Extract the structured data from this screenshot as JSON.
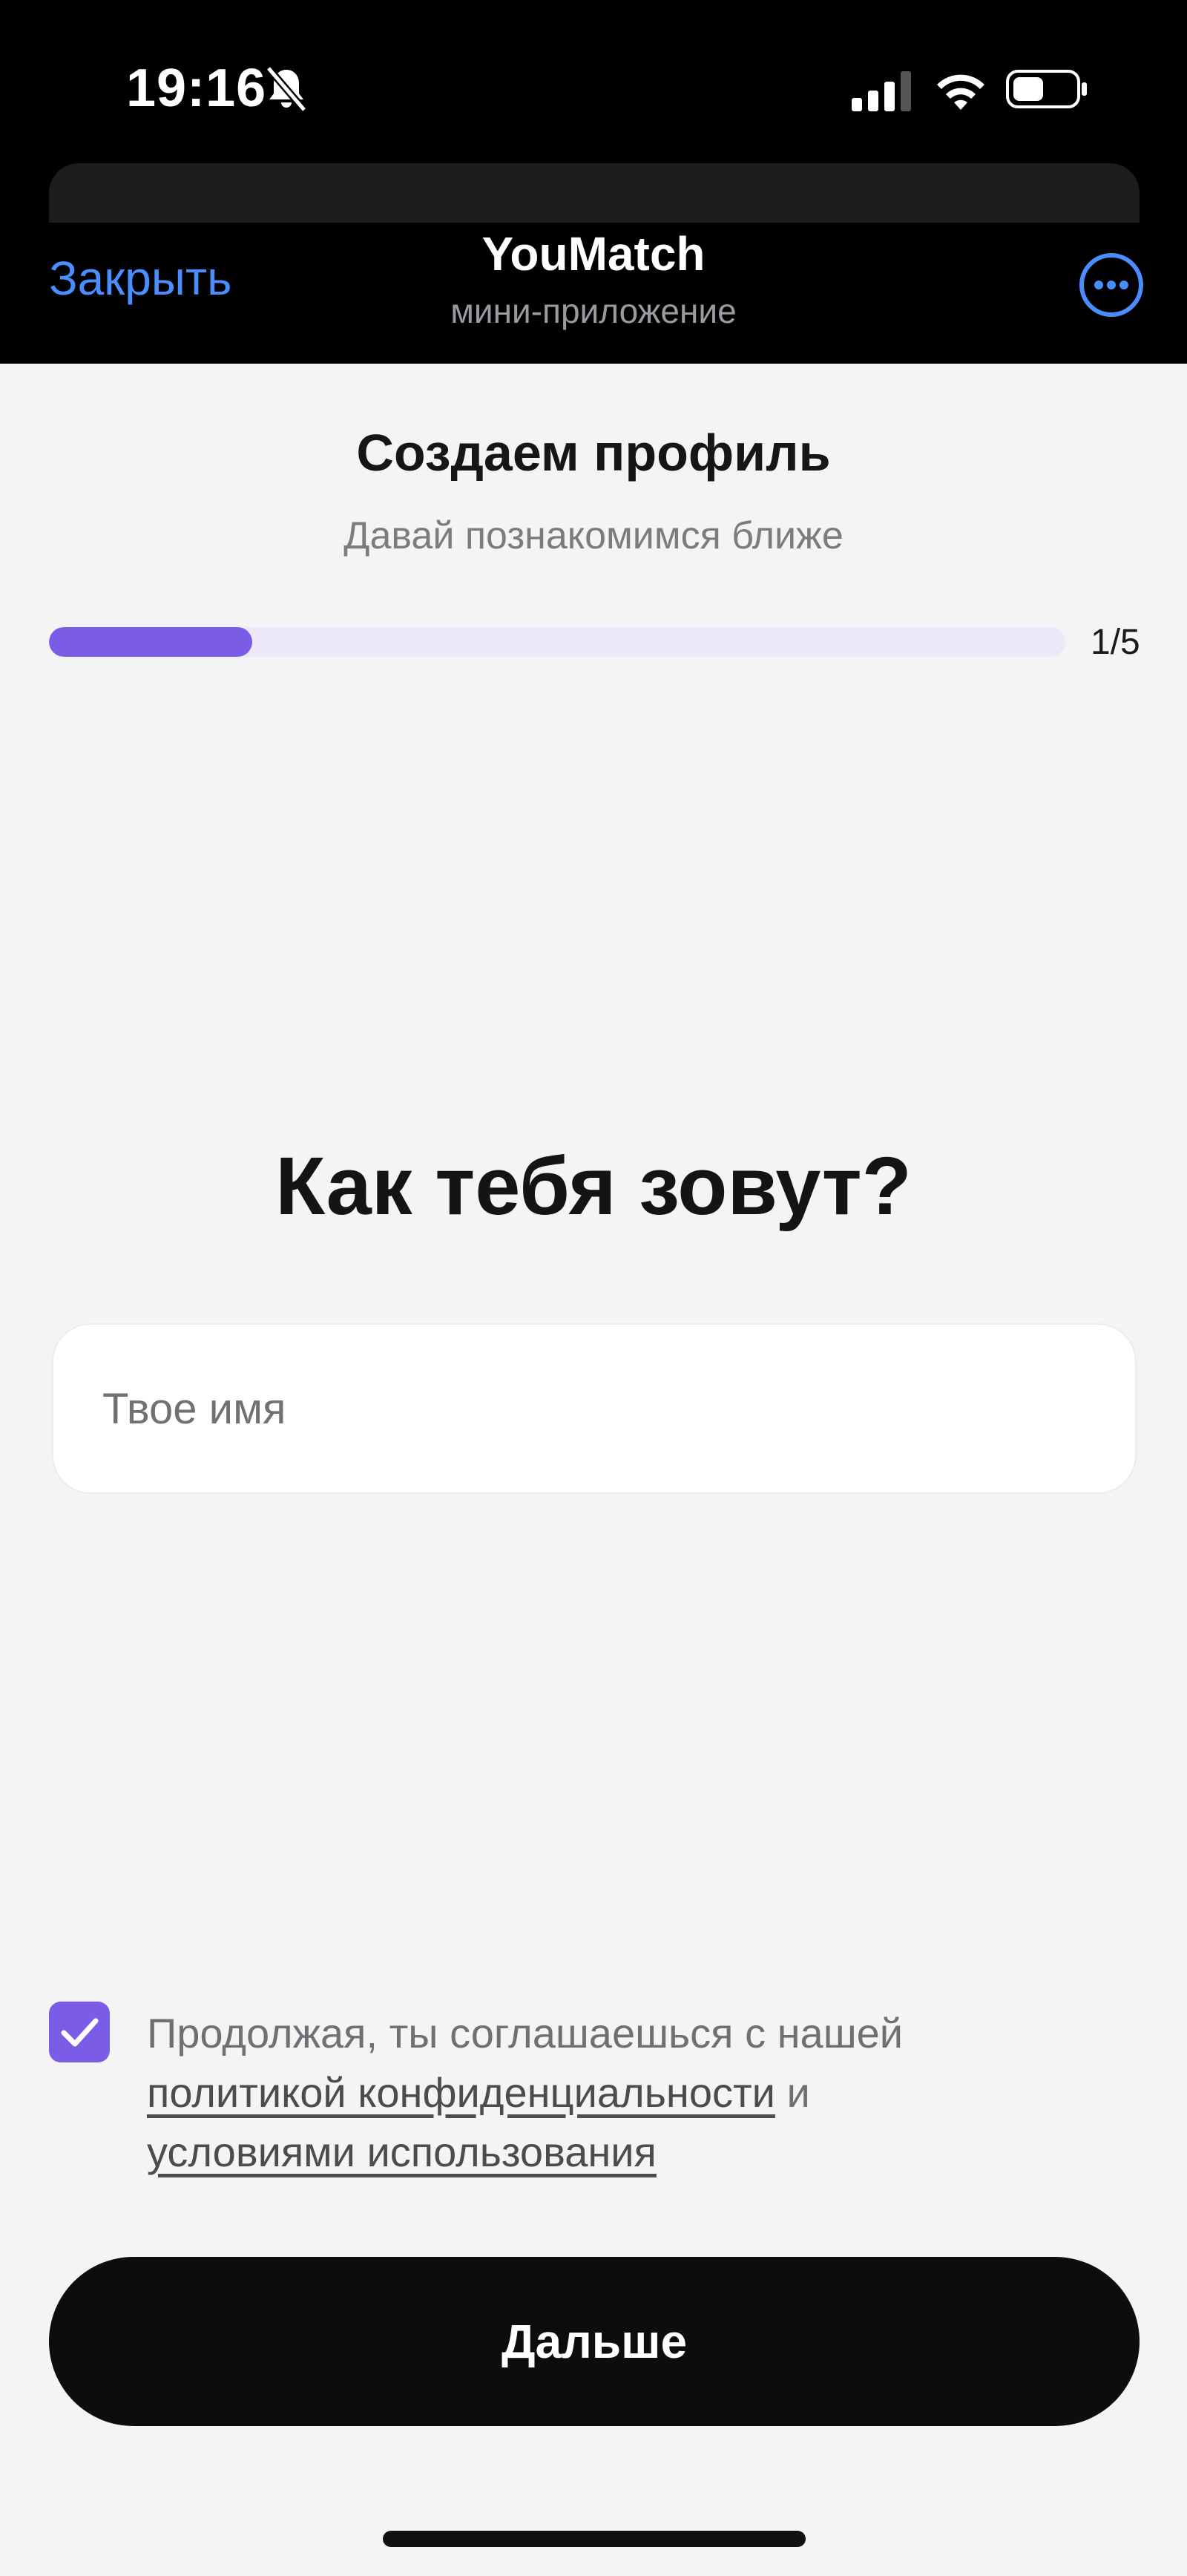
{
  "status_bar": {
    "time": "19:16",
    "icons": [
      "bell-off-icon",
      "signal-icon",
      "wifi-icon",
      "battery-icon"
    ]
  },
  "header": {
    "close_label": "Закрыть",
    "title": "YouMatch",
    "subtitle": "мини-приложение",
    "more_icon": "ellipsis-icon"
  },
  "profile": {
    "heading": "Создаем профиль",
    "subheading": "Давай познакомимся ближе",
    "progress": {
      "current": 1,
      "total": 5,
      "label": "1/5"
    }
  },
  "form": {
    "question": "Как тебя зовут?",
    "name_placeholder": "Твое имя",
    "name_value": ""
  },
  "consent": {
    "checked": true,
    "text_before": "Продолжая, ты соглашаешься с нашей",
    "privacy_link": "политикой конфиденциальности",
    "conjunction": "и",
    "terms_link": "условиями использования"
  },
  "actions": {
    "next_label": "Дальше"
  },
  "colors": {
    "accent": "#7b5ce6",
    "link_blue": "#4a8dff",
    "background": "#f4f4f5",
    "button": "#0d0d0d"
  }
}
